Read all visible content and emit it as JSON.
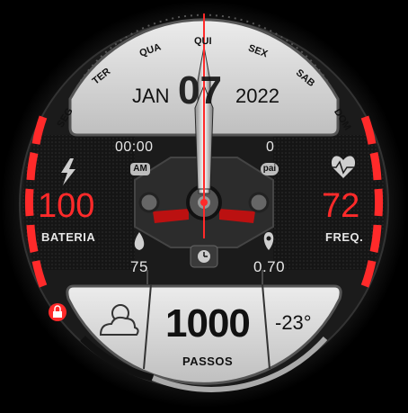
{
  "weekdays": [
    "SEG",
    "TER",
    "QUA",
    "QUI",
    "SEX",
    "SAB",
    "DOM"
  ],
  "date": {
    "month": "JAN",
    "day": "07",
    "year": "2022"
  },
  "left": {
    "time": "00:00",
    "ampm": "AM",
    "battery_value": "100",
    "battery_label": "BATERIA",
    "water_value": "75"
  },
  "right": {
    "pai_value": "0",
    "pai_badge": "pai",
    "heart_value": "72",
    "heart_label": "FREQ.",
    "distance_value": "0.70"
  },
  "bottom": {
    "steps_value": "1000",
    "steps_label": "PASSOS",
    "temperature": "-23°"
  },
  "icons": {
    "battery": "lightning-bolt-icon",
    "heart": "heart-rate-icon",
    "water": "water-drop-icon",
    "location": "location-pin-icon",
    "lock": "lock-icon",
    "weather": "partly-cloudy-icon",
    "alarm": "alarm-clock-icon"
  },
  "colors": {
    "accent": "#ff2a2a",
    "panel": "#d9d9d9",
    "bezel": "#1a1a1a"
  }
}
